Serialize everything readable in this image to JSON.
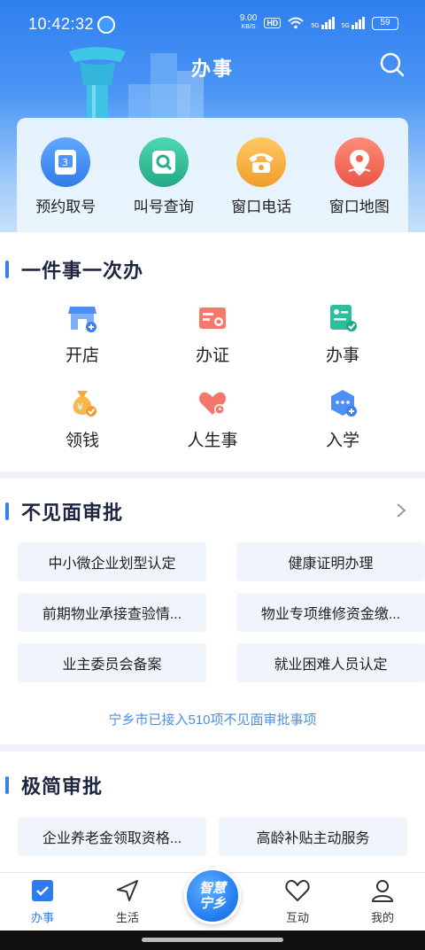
{
  "status_bar": {
    "time": "10:42:32",
    "net_speed": "9.00",
    "net_unit": "KB/S",
    "hd": "HD",
    "sig1": "5G",
    "sig2": "5G",
    "battery": "59"
  },
  "header": {
    "title": "办事"
  },
  "quick_actions": [
    {
      "label": "预约取号",
      "icon": "ticket-icon",
      "color": "#3f8ef5"
    },
    {
      "label": "叫号查询",
      "icon": "search-screen-icon",
      "color": "#31c29a"
    },
    {
      "label": "窗口电话",
      "icon": "phone-icon",
      "color": "#f5b03c"
    },
    {
      "label": "窗口地图",
      "icon": "map-pin-icon",
      "color": "#f26a5a"
    }
  ],
  "one_thing": {
    "title": "一件事一次办",
    "items": [
      {
        "label": "开店",
        "icon": "shop-icon"
      },
      {
        "label": "办证",
        "icon": "certificate-icon"
      },
      {
        "label": "办事",
        "icon": "checklist-icon"
      },
      {
        "label": "领钱",
        "icon": "money-bag-icon"
      },
      {
        "label": "人生事",
        "icon": "heart-calendar-icon"
      },
      {
        "label": "入学",
        "icon": "school-icon"
      }
    ]
  },
  "no_meet": {
    "title": "不见面审批",
    "items": [
      "中小微企业划型认定",
      "健康证明办理",
      "前期物业承接查验情...",
      "物业专项维修资金缴...",
      "业主委员会备案",
      "就业困难人员认定"
    ],
    "note": "宁乡市已接入510项不见面审批事项"
  },
  "simple": {
    "title": "极简审批",
    "items": [
      "企业养老金领取资格...",
      "高龄补贴主动服务"
    ]
  },
  "tabbar": {
    "tabs": [
      "办事",
      "生活",
      "互动",
      "我的"
    ],
    "center_line1": "智慧",
    "center_line2": "宁乡"
  }
}
